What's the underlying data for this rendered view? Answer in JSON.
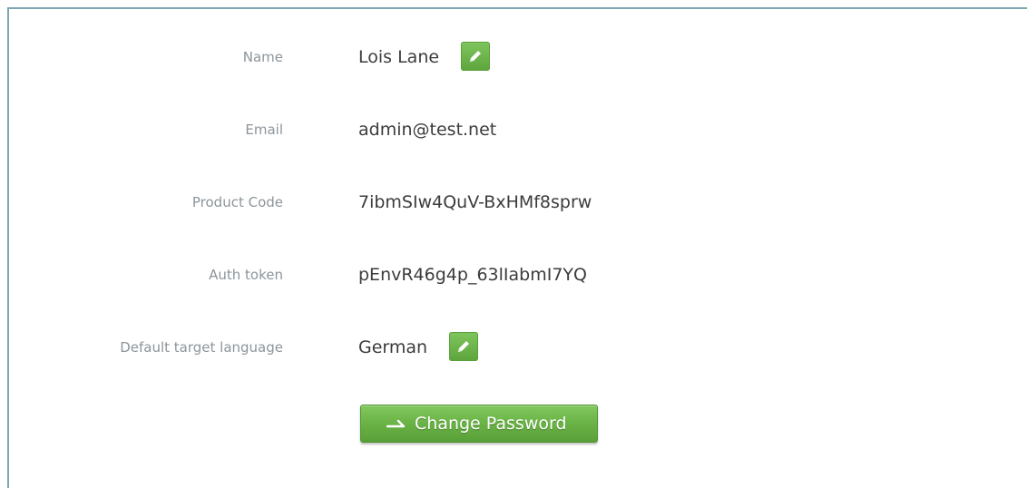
{
  "profile": {
    "name": {
      "label": "Name",
      "value": "Lois Lane"
    },
    "email": {
      "label": "Email",
      "value": "admin@test.net"
    },
    "product_code": {
      "label": "Product Code",
      "value": "7ibmSIw4QuV-BxHMf8sprw"
    },
    "auth_token": {
      "label": "Auth token",
      "value": "pEnvR46g4p_63lIabmI7YQ"
    },
    "language": {
      "label": "Default target language",
      "value": "German"
    }
  },
  "actions": {
    "change_password_label": "Change Password"
  },
  "icons": {
    "edit": "pencil-icon",
    "change_password": "arrow-right-icon"
  },
  "colors": {
    "accent_green": "#67b043",
    "label_gray": "#8c959b",
    "value_text": "#3c3c3c",
    "panel_border": "#7da7b4"
  }
}
